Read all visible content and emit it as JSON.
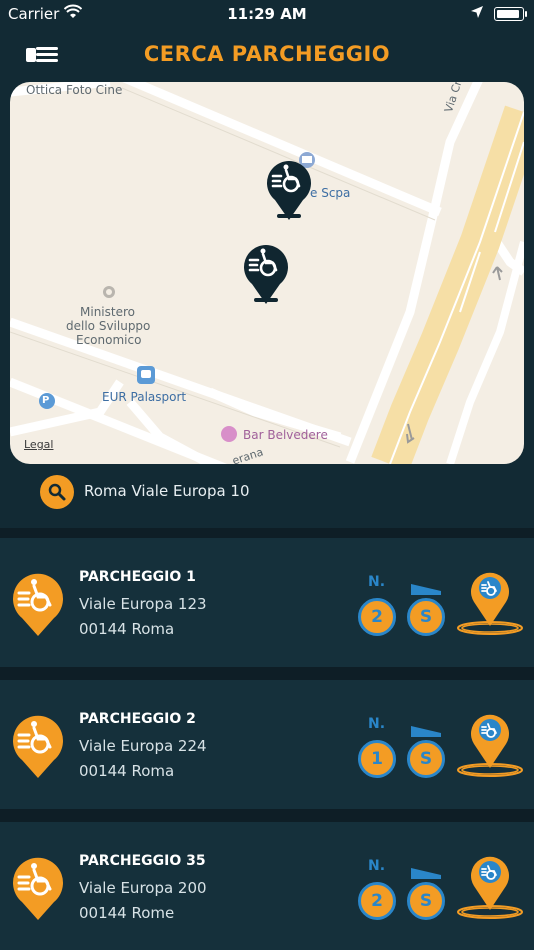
{
  "status_bar": {
    "carrier": "Carrier",
    "time": "11:29 AM"
  },
  "header": {
    "title": "CERCA PARCHEGGIO"
  },
  "map": {
    "labels": {
      "optics": "Ottica Foto Cine",
      "scpa": "e Scpa",
      "ministry_1": "Ministero",
      "ministry_2": "dello Sviluppo",
      "ministry_3": "Economico",
      "eur": "EUR Palasport",
      "bar": "Bar Belvedere",
      "street_a": "Via Cristoforo",
      "street_b": "erana",
      "parking_p": "P"
    },
    "legal": "Legal"
  },
  "search": {
    "query": "Roma Viale Europa 10"
  },
  "parkings": [
    {
      "name": "PARCHEGGIO 1",
      "street": "Viale Europa 123",
      "city": "00144 Roma",
      "n_label": "N.",
      "number": "2",
      "s_label": "S"
    },
    {
      "name": "PARCHEGGIO 2",
      "street": "Viale Europa  224",
      "city": "00144 Roma",
      "n_label": "N.",
      "number": "1",
      "s_label": "S"
    },
    {
      "name": "PARCHEGGIO 35",
      "street": "Viale Europa 200",
      "city": "00144 Rome",
      "n_label": "N.",
      "number": "2",
      "s_label": "S"
    }
  ],
  "colors": {
    "accent": "#f39c24",
    "blue": "#2a86c9",
    "background": "#0e1e26",
    "card": "#15303b",
    "header": "#122a34"
  }
}
